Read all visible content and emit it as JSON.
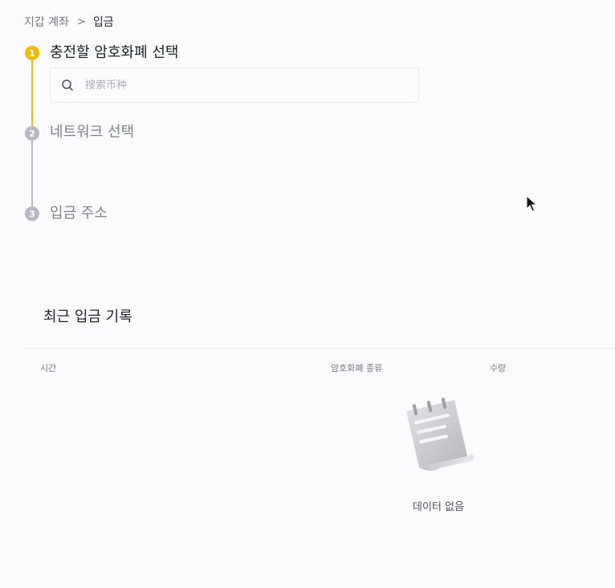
{
  "breadcrumb": {
    "parent": "지갑 계좌",
    "separator": ">",
    "current": "입금"
  },
  "steps": [
    {
      "number": "1",
      "title": "충전할 암호화폐 선택",
      "state": "active"
    },
    {
      "number": "2",
      "title": "네트워크 선택",
      "state": "inactive"
    },
    {
      "number": "3",
      "title": "입금 주소",
      "state": "inactive"
    }
  ],
  "search": {
    "placeholder": "搜索币种",
    "value": "",
    "icon": "search-icon"
  },
  "recent_deposits": {
    "title": "최근 입금 기록",
    "columns": [
      "시간",
      "암호화폐 종류",
      "수량"
    ],
    "rows": [],
    "empty_text": "데이터 없음",
    "empty_icon": "empty-notepad-icon"
  },
  "colors": {
    "accent": "#f0b90b",
    "inactive": "#b7bac2",
    "background": "#fbfbfd"
  }
}
